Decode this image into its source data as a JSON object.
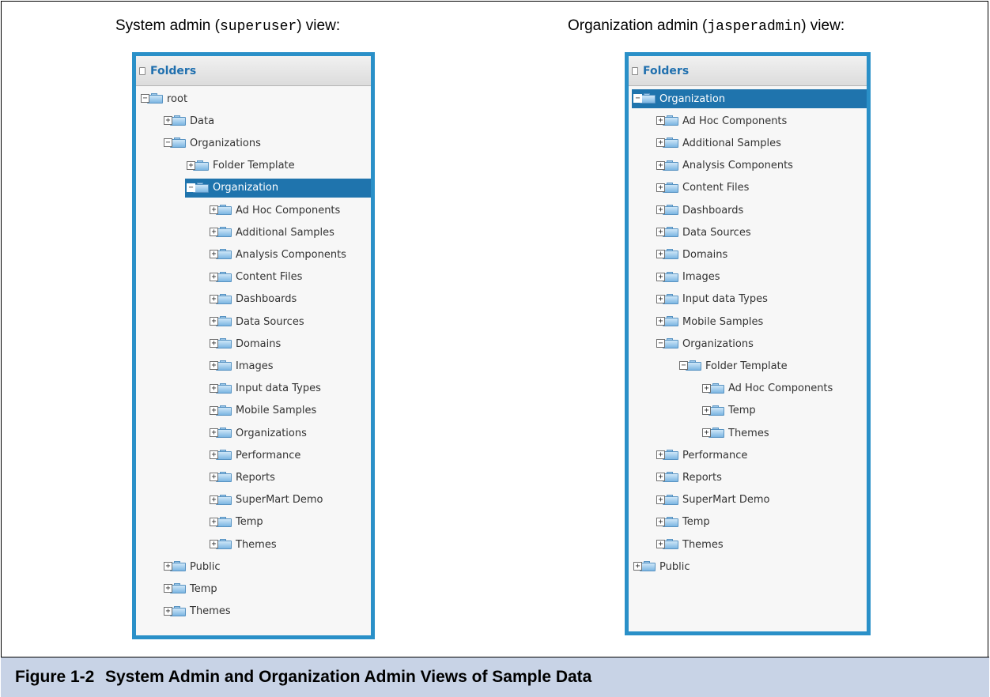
{
  "left_view": {
    "label_prefix": "System admin (",
    "label_code": "superuser",
    "label_suffix": ") view:",
    "panel_title": "Folders",
    "tree": [
      {
        "label": "root",
        "level": 0,
        "state": "expanded"
      },
      {
        "label": "Data",
        "level": 1,
        "state": "collapsed"
      },
      {
        "label": "Organizations",
        "level": 1,
        "state": "expanded"
      },
      {
        "label": "Folder Template",
        "level": 2,
        "state": "collapsed"
      },
      {
        "label": "Organization",
        "level": 2,
        "state": "expanded",
        "selected": true
      },
      {
        "label": "Ad Hoc Components",
        "level": 3,
        "state": "collapsed"
      },
      {
        "label": "Additional Samples",
        "level": 3,
        "state": "collapsed"
      },
      {
        "label": "Analysis Components",
        "level": 3,
        "state": "collapsed"
      },
      {
        "label": "Content Files",
        "level": 3,
        "state": "collapsed"
      },
      {
        "label": "Dashboards",
        "level": 3,
        "state": "collapsed"
      },
      {
        "label": "Data Sources",
        "level": 3,
        "state": "collapsed"
      },
      {
        "label": "Domains",
        "level": 3,
        "state": "collapsed"
      },
      {
        "label": "Images",
        "level": 3,
        "state": "collapsed"
      },
      {
        "label": "Input data Types",
        "level": 3,
        "state": "collapsed"
      },
      {
        "label": "Mobile Samples",
        "level": 3,
        "state": "collapsed"
      },
      {
        "label": "Organizations",
        "level": 3,
        "state": "collapsed"
      },
      {
        "label": "Performance",
        "level": 3,
        "state": "collapsed"
      },
      {
        "label": "Reports",
        "level": 3,
        "state": "collapsed"
      },
      {
        "label": "SuperMart Demo",
        "level": 3,
        "state": "collapsed"
      },
      {
        "label": "Temp",
        "level": 3,
        "state": "collapsed"
      },
      {
        "label": "Themes",
        "level": 3,
        "state": "collapsed"
      },
      {
        "label": "Public",
        "level": 1,
        "state": "collapsed"
      },
      {
        "label": "Temp",
        "level": 1,
        "state": "collapsed"
      },
      {
        "label": "Themes",
        "level": 1,
        "state": "collapsed"
      }
    ]
  },
  "right_view": {
    "label_prefix": "Organization admin (",
    "label_code": "jasperadmin",
    "label_suffix": ") view:",
    "panel_title": "Folders",
    "tree": [
      {
        "label": "Organization",
        "level": 0,
        "state": "expanded",
        "selected": true
      },
      {
        "label": "Ad Hoc Components",
        "level": 1,
        "state": "collapsed"
      },
      {
        "label": "Additional Samples",
        "level": 1,
        "state": "collapsed"
      },
      {
        "label": "Analysis Components",
        "level": 1,
        "state": "collapsed"
      },
      {
        "label": "Content Files",
        "level": 1,
        "state": "collapsed"
      },
      {
        "label": "Dashboards",
        "level": 1,
        "state": "collapsed"
      },
      {
        "label": "Data Sources",
        "level": 1,
        "state": "collapsed"
      },
      {
        "label": "Domains",
        "level": 1,
        "state": "collapsed"
      },
      {
        "label": "Images",
        "level": 1,
        "state": "collapsed"
      },
      {
        "label": "Input data Types",
        "level": 1,
        "state": "collapsed"
      },
      {
        "label": "Mobile Samples",
        "level": 1,
        "state": "collapsed"
      },
      {
        "label": "Organizations",
        "level": 1,
        "state": "expanded"
      },
      {
        "label": "Folder Template",
        "level": 2,
        "state": "expanded"
      },
      {
        "label": "Ad Hoc Components",
        "level": 3,
        "state": "collapsed"
      },
      {
        "label": "Temp",
        "level": 3,
        "state": "collapsed"
      },
      {
        "label": "Themes",
        "level": 3,
        "state": "collapsed"
      },
      {
        "label": "Performance",
        "level": 1,
        "state": "collapsed"
      },
      {
        "label": "Reports",
        "level": 1,
        "state": "collapsed"
      },
      {
        "label": "SuperMart Demo",
        "level": 1,
        "state": "collapsed"
      },
      {
        "label": "Temp",
        "level": 1,
        "state": "collapsed"
      },
      {
        "label": "Themes",
        "level": 1,
        "state": "collapsed"
      },
      {
        "label": "Public",
        "level": 0,
        "state": "collapsed"
      }
    ]
  },
  "caption": {
    "number": "Figure 1-2",
    "text": "System Admin and Organization Admin Views of Sample Data"
  }
}
